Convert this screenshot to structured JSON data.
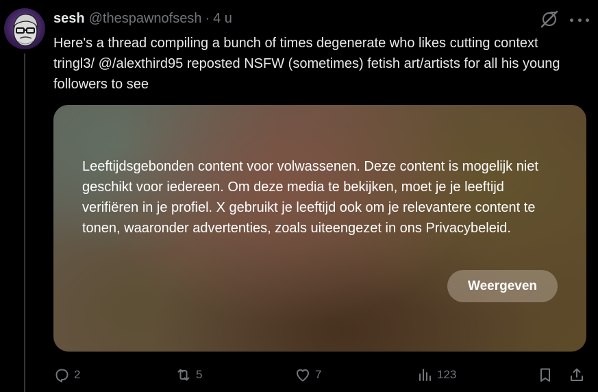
{
  "author": {
    "display_name": "sesh",
    "handle": "@thespawnofsesh",
    "separator": "·",
    "timestamp": "4 u"
  },
  "tweet": {
    "text": "Here's a thread compiling a bunch of times degenerate who likes cutting context tringl3/ @/alexthird95 reposted NSFW (sometimes) fetish art/artists for all his young followers to see"
  },
  "media": {
    "warning_text": "Leeftijdsgebonden content voor volwassenen. Deze content is mogelijk niet geschikt voor iedereen. Om deze media te bekijken, moet je je leeftijd verifiëren in je profiel. X gebruikt je leeftijd ook om je relevantere content te tonen, waaronder advertenties, zoals uiteengezet in ons Privacybeleid.",
    "reveal_button_label": "Weergeven"
  },
  "actions": {
    "replies": "2",
    "reposts": "5",
    "likes": "7",
    "views": "123"
  },
  "icons": {
    "reply": "reply-icon",
    "repost": "repost-icon",
    "like": "heart-icon",
    "views": "views-icon",
    "bookmark": "bookmark-icon",
    "share": "share-icon",
    "grok": "grok-icon",
    "more": "more-icon"
  },
  "colors": {
    "background": "#000000",
    "text_primary": "#e7e9ea",
    "text_secondary": "#71767b",
    "thread_line": "#333639"
  }
}
